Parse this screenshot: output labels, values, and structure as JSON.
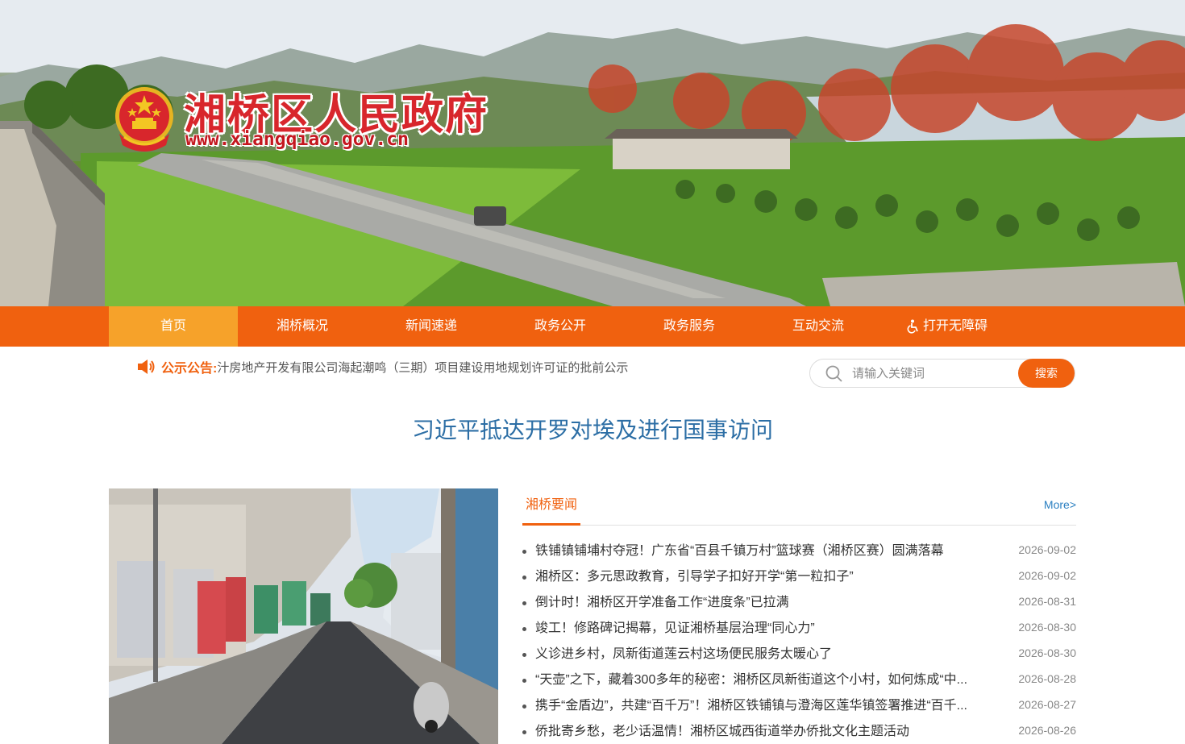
{
  "header": {
    "site_name": "湘桥区人民政府",
    "site_url": "www.xiangqiao.gov.cn",
    "emblem_icon": "national-emblem-icon"
  },
  "nav": {
    "items": [
      {
        "label": "首页",
        "active": true
      },
      {
        "label": "湘桥概况",
        "active": false
      },
      {
        "label": "新闻速递",
        "active": false
      },
      {
        "label": "政务公开",
        "active": false
      },
      {
        "label": "政务服务",
        "active": false
      },
      {
        "label": "互动交流",
        "active": false
      }
    ],
    "accessibility_label": "打开无障碍",
    "accessibility_icon": "wheelchair-icon"
  },
  "notice": {
    "label": "公示公告:",
    "text": "汁房地产开发有限公司海起潮鸣（三期）项目建设用地规划许可证的批前公示",
    "icon": "horn-icon"
  },
  "search": {
    "placeholder": "请输入关键词",
    "value": "",
    "button_label": "搜索",
    "icon": "search-icon"
  },
  "headline": {
    "text": "习近平抵达开罗对埃及进行国事访问"
  },
  "news": {
    "tab_label": "湘桥要闻",
    "more_label": "More>",
    "items": [
      {
        "title": "铁铺镇铺埔村夺冠！广东省“百县千镇万村”篮球赛（湘桥区赛）圆满落幕",
        "date": "2026-09-02"
      },
      {
        "title": "湘桥区：多元思政教育，引导学子扣好开学“第一粒扣子”",
        "date": "2026-09-02"
      },
      {
        "title": "倒计时！湘桥区开学准备工作“进度条”已拉满",
        "date": "2026-08-31"
      },
      {
        "title": "竣工！修路碑记揭幕，见证湘桥基层治理“同心力”",
        "date": "2026-08-30"
      },
      {
        "title": "义诊进乡村，凤新街道莲云村这场便民服务太暖心了",
        "date": "2026-08-30"
      },
      {
        "title": "“天壶”之下，藏着300多年的秘密：湘桥区凤新街道这个小村，如何炼成“中...",
        "date": "2026-08-28"
      },
      {
        "title": "携手“金盾边”，共建“百千万”！湘桥区铁铺镇与澄海区莲华镇签署推进“百千...",
        "date": "2026-08-27"
      },
      {
        "title": "侨批寄乡愁，老少话温情！湘桥区城西街道举办侨批文化主题活动",
        "date": "2026-08-26"
      }
    ]
  },
  "colors": {
    "nav_bg": "#f0610f",
    "nav_active": "#f6a22a",
    "brand_red": "#d8262c",
    "headline": "#2c6ea5"
  }
}
